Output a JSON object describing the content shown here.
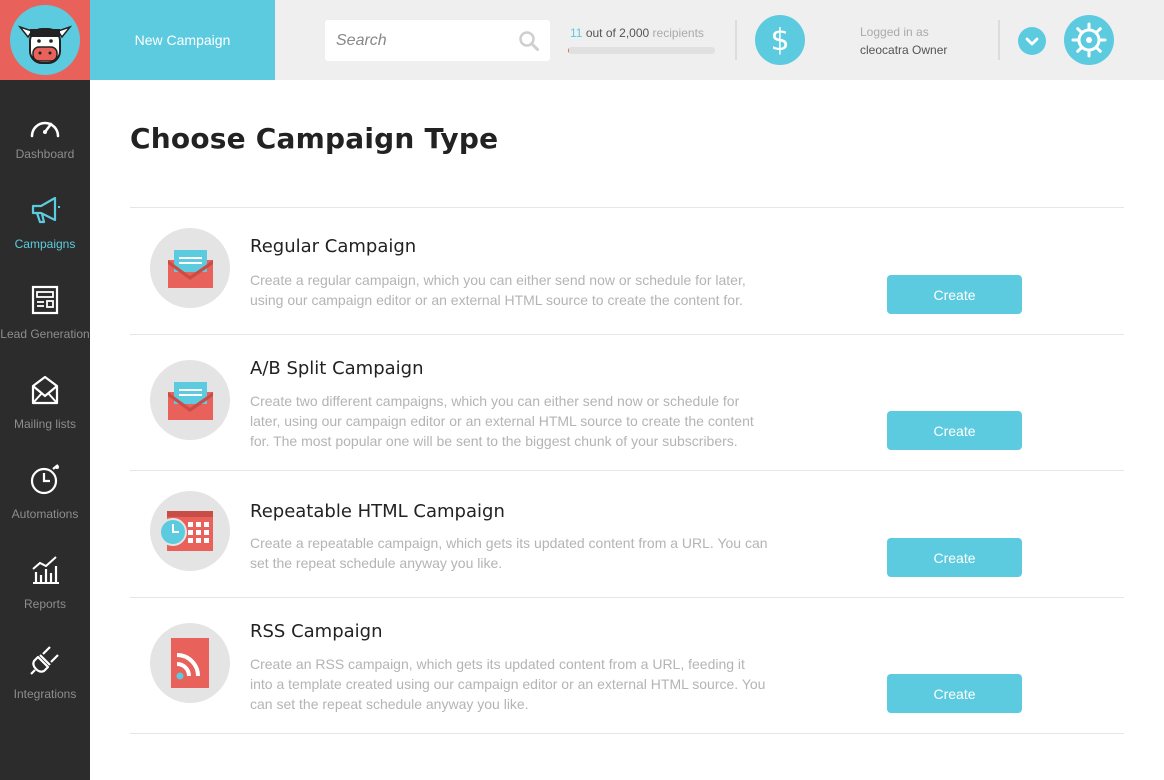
{
  "header": {
    "new_campaign_label": "New Campaign",
    "search_placeholder": "Search",
    "recipients_count": "11",
    "recipients_text": "out of 2,000",
    "recipients_suffix": "recipients",
    "recipients_used_fraction": 0.0055,
    "logged_in_label": "Logged in as",
    "user_name": "cleocatra",
    "user_role": "Owner"
  },
  "sidebar": {
    "items": [
      {
        "label": "Dashboard",
        "icon": "speedometer-icon"
      },
      {
        "label": "Campaigns",
        "icon": "megaphone-icon",
        "active": true
      },
      {
        "label": "Lead Generation",
        "icon": "form-icon"
      },
      {
        "label": "Mailing lists",
        "icon": "envelope-icon"
      },
      {
        "label": "Automations",
        "icon": "clock-icon"
      },
      {
        "label": "Reports",
        "icon": "chart-icon"
      },
      {
        "label": "Integrations",
        "icon": "plug-icon"
      }
    ]
  },
  "main": {
    "title": "Choose Campaign Type",
    "campaigns": [
      {
        "title": "Regular Campaign",
        "description": "Create a regular campaign, which you can either send now or schedule for later, using our campaign editor or an external HTML source to create the content for.",
        "button": "Create",
        "icon": "envelope-icon"
      },
      {
        "title": "A/B Split Campaign",
        "description": "Create two different campaigns, which you can either send now or schedule for later, using our campaign editor or an external HTML source to create the content for. The most popular one will be sent to the biggest chunk of your subscribers.",
        "button": "Create",
        "icon": "envelope-split-icon"
      },
      {
        "title": "Repeatable HTML Campaign",
        "description": "Create a repeatable campaign, which gets its updated content from a URL. You can set the repeat schedule anyway you like.",
        "button": "Create",
        "icon": "calendar-clock-icon"
      },
      {
        "title": "RSS Campaign",
        "description": "Create an RSS campaign, which gets its updated content from a URL, feeding it into a template created using our campaign editor or an external HTML source. You can set the repeat schedule anyway you like.",
        "button": "Create",
        "icon": "rss-icon"
      }
    ]
  },
  "colors": {
    "accent": "#5ccbdf",
    "brand_red": "#e8615a",
    "sidebar_bg": "#2c2c2c",
    "topbar_bg": "#efefef"
  }
}
